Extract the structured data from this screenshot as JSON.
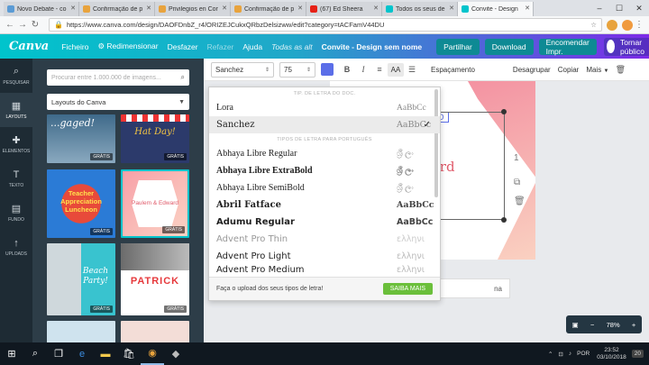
{
  "browser": {
    "tabs": [
      {
        "title": "Novo Debate - co",
        "color": "#5b9bd5",
        "active": false
      },
      {
        "title": "Confirmação de p",
        "color": "#e8a33d",
        "active": false
      },
      {
        "title": "Privilegios en Cor",
        "color": "#e8a33d",
        "active": false
      },
      {
        "title": "Confirmação de p",
        "color": "#e8a33d",
        "active": false
      },
      {
        "title": "(67) Ed Sheera",
        "color": "#e62117",
        "active": false
      },
      {
        "title": "Todos os seus de",
        "color": "#00c4cc",
        "active": false
      },
      {
        "title": "Convite - Design",
        "color": "#00c4cc",
        "active": true
      }
    ],
    "url": "https://www.canva.com/design/DAOFDnbZ_r4/ORIZEJCukxQRbzDelsizww/edit?category=tACFamV44DU"
  },
  "canva": {
    "logo": "Canva",
    "menu": {
      "file": "Ficheiro",
      "resize": "Redimensionar",
      "undo": "Desfazer",
      "redo": "Refazer",
      "help": "Ajuda",
      "saved": "Todas as alt",
      "title": "Convite - Design sem nome"
    },
    "buttons": {
      "share": "Partilhar",
      "download": "Download",
      "order": "Encomendar Impr.",
      "public": "Tornar público"
    }
  },
  "rail": [
    {
      "icon": "⌕",
      "label": "PESQUISAR"
    },
    {
      "icon": "▦",
      "label": "LAYOUTS"
    },
    {
      "icon": "✚",
      "label": "ELEMENTOS"
    },
    {
      "icon": "T",
      "label": "TEXTO"
    },
    {
      "icon": "▤",
      "label": "FUNDO"
    },
    {
      "icon": "↑",
      "label": "UPLOADS"
    }
  ],
  "panel": {
    "search_placeholder": "Procurar entre 1.000.000 de imagens...",
    "layouts_label": "Layouts do Canva",
    "free_badge": "GRÁTIS",
    "thumbs": [
      {
        "text": "...gaged!"
      },
      {
        "text": "Hat Day!"
      },
      {
        "text": "Teacher Appreciation Luncheon"
      },
      {
        "text": "Paulem & Edward"
      },
      {
        "text": "Beach Party!"
      },
      {
        "text": "PATRICK"
      }
    ]
  },
  "toolbar": {
    "font": "Sanchez",
    "size": "75",
    "bold": "B",
    "italic": "I",
    "aa": "AA",
    "spacing": "Espaçamento",
    "ungroup": "Desagrupar",
    "copy": "Copiar",
    "more": "Mais"
  },
  "font_dropdown": {
    "header_recent": "TIP. DE LETRA DO DOC.",
    "header_pt": "TIPOS DE LETRA PARA PORTUGUÊS",
    "recent": [
      {
        "name": "Lora",
        "sample": "AaBbCc",
        "selected": false
      },
      {
        "name": "Sanchez",
        "sample": "AaBbCc",
        "selected": true
      }
    ],
    "fonts": [
      {
        "name": "Abhaya Libre Regular",
        "sample": "ශ්‍රී ලං"
      },
      {
        "name": "Abhaya Libre ExtraBold",
        "sample": "ශ්‍රී ලං"
      },
      {
        "name": "Abhaya Libre SemiBold",
        "sample": "ශ්‍රී ලං"
      },
      {
        "name": "Abril Fatface",
        "sample": "AaBbCc"
      },
      {
        "name": "Adumu Regular",
        "sample": "AaBbCc"
      },
      {
        "name": "Advent Pro Thin",
        "sample": "ελληνι"
      },
      {
        "name": "Advent Pro Light",
        "sample": "ελληνι"
      },
      {
        "name": "Advent Pro Medium",
        "sample": "ελληνι"
      }
    ],
    "check": "✓",
    "footer_text": "Faça o upload dos seus tipos de letra!",
    "footer_button": "SAIBA MAIS"
  },
  "canvas": {
    "text_ward": "ward",
    "text_vio": "VIO",
    "notes": "na"
  },
  "zoom": {
    "value": "78%",
    "minus": "−",
    "plus": "+"
  },
  "taskbar": {
    "lang": "POR",
    "time": "23:52",
    "date": "03/10/2018",
    "notif": "20"
  }
}
